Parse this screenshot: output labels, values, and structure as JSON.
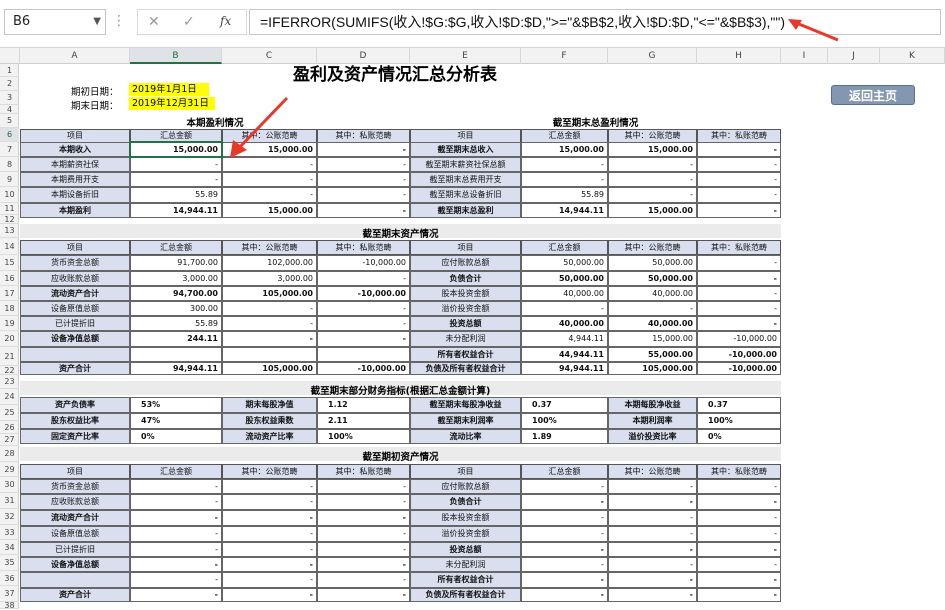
{
  "formula_bar": {
    "name_box": "B6",
    "cancel_icon": "✕",
    "enter_icon": "✓",
    "fx": "fx",
    "formula": "=IFERROR(SUMIFS(收入!$G:$G,收入!$D:$D,\">=\"&$B$2,收入!$D:$D,\"<=\"&$B$3),\"\")"
  },
  "columns": [
    "A",
    "B",
    "C",
    "D",
    "E",
    "F",
    "G",
    "H",
    "I",
    "J",
    "K"
  ],
  "rows": [
    "1",
    "2",
    "3",
    "4",
    "5",
    "6",
    "7",
    "8",
    "9",
    "10",
    "11",
    "12",
    "13",
    "14",
    "15",
    "16",
    "17",
    "18",
    "19",
    "20",
    "21",
    "22",
    "23",
    "24",
    "25",
    "26",
    "27",
    "28",
    "29",
    "30",
    "31",
    "32",
    "33",
    "34",
    "35",
    "36",
    "37",
    "38"
  ],
  "title": "盈利及资产情况汇总分析表",
  "dates": {
    "start_label": "期初日期：",
    "start_value": "2019年1月1日",
    "end_label": "期末日期：",
    "end_value": "2019年12月31日"
  },
  "home_button": "返回主页",
  "hdr": {
    "item": "项目",
    "total": "汇总金额",
    "public": "其中：公账范畴",
    "private": "其中：私账范畴"
  },
  "profit_period": {
    "title": "本期盈利情况",
    "rows": [
      {
        "label": "本期收入",
        "total": "15,000.00",
        "pub": "15,000.00",
        "pri": "-"
      },
      {
        "label": "本期薪资社保",
        "total": "-",
        "pub": "-",
        "pri": "-"
      },
      {
        "label": "本期费用开支",
        "total": "-",
        "pub": "-",
        "pri": "-"
      },
      {
        "label": "本期设备折旧",
        "total": "55.89",
        "pub": "-",
        "pri": "-"
      },
      {
        "label": "本期盈利",
        "total": "14,944.11",
        "pub": "15,000.00",
        "pri": "-"
      }
    ]
  },
  "profit_total": {
    "title": "截至期末总盈利情况",
    "rows": [
      {
        "label": "截至期末总收入",
        "total": "15,000.00",
        "pub": "15,000.00",
        "pri": "-"
      },
      {
        "label": "截至期末薪资社保总额",
        "total": "-",
        "pub": "-",
        "pri": "-"
      },
      {
        "label": "截至期末总费用开支",
        "total": "-",
        "pub": "-",
        "pri": "-"
      },
      {
        "label": "截至期末总设备折旧",
        "total": "55.89",
        "pub": "-",
        "pri": "-"
      },
      {
        "label": "截至期末总盈利",
        "total": "14,944.11",
        "pub": "15,000.00",
        "pri": "-"
      }
    ]
  },
  "assets_end": {
    "title": "截至期末资产情况",
    "left": [
      {
        "label": "货币资金总额",
        "total": "91,700.00",
        "pub": "102,000.00",
        "pri": "-10,000.00"
      },
      {
        "label": "应收账款总额",
        "total": "3,000.00",
        "pub": "3,000.00",
        "pri": "-"
      },
      {
        "label": "流动资产合计",
        "total": "94,700.00",
        "pub": "105,000.00",
        "pri": "-10,000.00"
      },
      {
        "label": "设备原值总额",
        "total": "300.00",
        "pub": "-",
        "pri": "-"
      },
      {
        "label": "已计提折旧",
        "total": "55.89",
        "pub": "-",
        "pri": "-"
      },
      {
        "label": "设备净值总额",
        "total": "244.11",
        "pub": "-",
        "pri": "-"
      },
      {
        "label": "",
        "total": "",
        "pub": "",
        "pri": ""
      },
      {
        "label": "资产合计",
        "total": "94,944.11",
        "pub": "105,000.00",
        "pri": "-10,000.00"
      }
    ],
    "right": [
      {
        "label": "应付账款总额",
        "total": "50,000.00",
        "pub": "50,000.00",
        "pri": "-"
      },
      {
        "label": "负债合计",
        "total": "50,000.00",
        "pub": "50,000.00",
        "pri": "-"
      },
      {
        "label": "股本投资金额",
        "total": "40,000.00",
        "pub": "40,000.00",
        "pri": "-"
      },
      {
        "label": "溢价投资金额",
        "total": "-",
        "pub": "-",
        "pri": "-"
      },
      {
        "label": "投资总额",
        "total": "40,000.00",
        "pub": "40,000.00",
        "pri": "-"
      },
      {
        "label": "未分配利润",
        "total": "4,944.11",
        "pub": "15,000.00",
        "pri": "-10,000.00"
      },
      {
        "label": "所有者权益合计",
        "total": "44,944.11",
        "pub": "55,000.00",
        "pri": "-10,000.00"
      },
      {
        "label": "负债及所有者权益合计",
        "total": "94,944.11",
        "pub": "105,000.00",
        "pri": "-10,000.00"
      }
    ]
  },
  "ratios": {
    "title": "截至期末部分财务指标(根据汇总金额计算)",
    "rows": [
      [
        "资产负债率",
        "53%",
        "期末每股净值",
        "1.12",
        "截至期末每股净收益",
        "0.37",
        "本期每股净收益",
        "0.37"
      ],
      [
        "股东权益比率",
        "47%",
        "股东权益乘数",
        "2.11",
        "截至期末利润率",
        "100%",
        "本期利润率",
        "100%"
      ],
      [
        "固定资产比率",
        "0%",
        "流动资产比率",
        "100%",
        "流动比率",
        "1.89",
        "溢价投资比率",
        "0%"
      ]
    ]
  },
  "assets_begin": {
    "title": "截至期初资产情况",
    "left": [
      "货币资金总额",
      "应收账款总额",
      "流动资产合计",
      "设备原值总额",
      "已计提折旧",
      "设备净值总额",
      "",
      "资产合计"
    ],
    "right": [
      "应付账款总额",
      "负债合计",
      "股本投资金额",
      "溢价投资金额",
      "投资总额",
      "未分配利润",
      "所有者权益合计",
      "负债及所有者权益合计"
    ],
    "dash": "-"
  }
}
